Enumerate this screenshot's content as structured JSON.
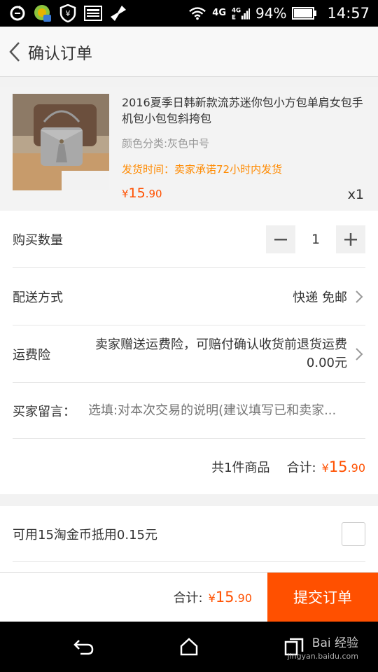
{
  "status_bar": {
    "battery": "94%",
    "time": "14:57",
    "network_top": "4G",
    "network_small": "4G"
  },
  "header": {
    "title": "确认订单"
  },
  "product": {
    "title": "2016夏季日韩新款流苏迷你包小方包单肩女包手机包小包包斜挎包",
    "spec": "颜色分类:灰色中号",
    "ship_time": "发货时间：卖家承诺72小时内发货",
    "price_symbol": "¥",
    "price_int": "15",
    "price_dec": ".90",
    "quantity": "x1"
  },
  "order": {
    "qty_label": "购买数量",
    "qty_value": "1",
    "delivery_label": "配送方式",
    "delivery_value": "快递 免邮",
    "insurance_label": "运费险",
    "insurance_value": "卖家赠送运费险，可赔付确认收货前退货运费0.00元",
    "message_label": "买家留言：",
    "message_placeholder": "选填:对本次交易的说明(建议填写已和卖家...",
    "total_count": "共1件商品",
    "total_label": "合计:",
    "total_symbol": "¥",
    "total_int": "15",
    "total_dec": ".90"
  },
  "coins": {
    "label": "可用15淘金币抵用0.15元",
    "checked": false
  },
  "bottom": {
    "total_label": "合计:",
    "total_symbol": "¥",
    "total_int": "15",
    "total_dec": ".90",
    "submit_label": "提交订单"
  },
  "watermark": {
    "brand": "Bai 经验",
    "url": "jingyan.baidu.com"
  },
  "colors": {
    "accent": "#ff5000",
    "ship_text": "#ff8a00"
  }
}
